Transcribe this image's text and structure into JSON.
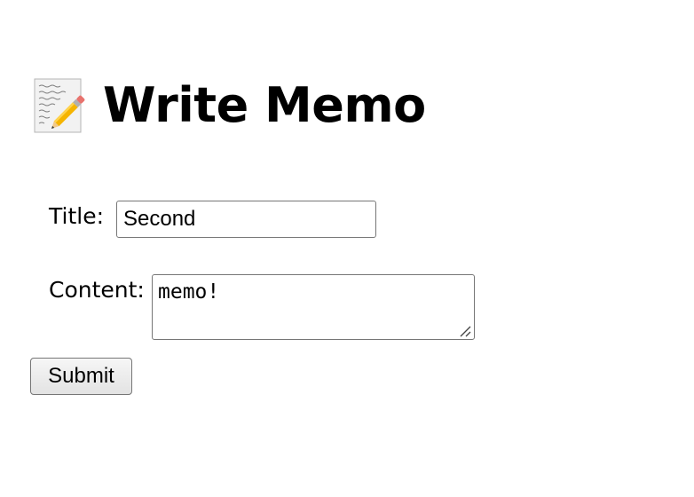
{
  "header": {
    "icon": "memo-icon",
    "title": "Write Memo"
  },
  "form": {
    "title_label": "Title:",
    "title_value": "Second",
    "content_label": "Content:",
    "content_value": "memo!",
    "submit_label": "Submit"
  }
}
